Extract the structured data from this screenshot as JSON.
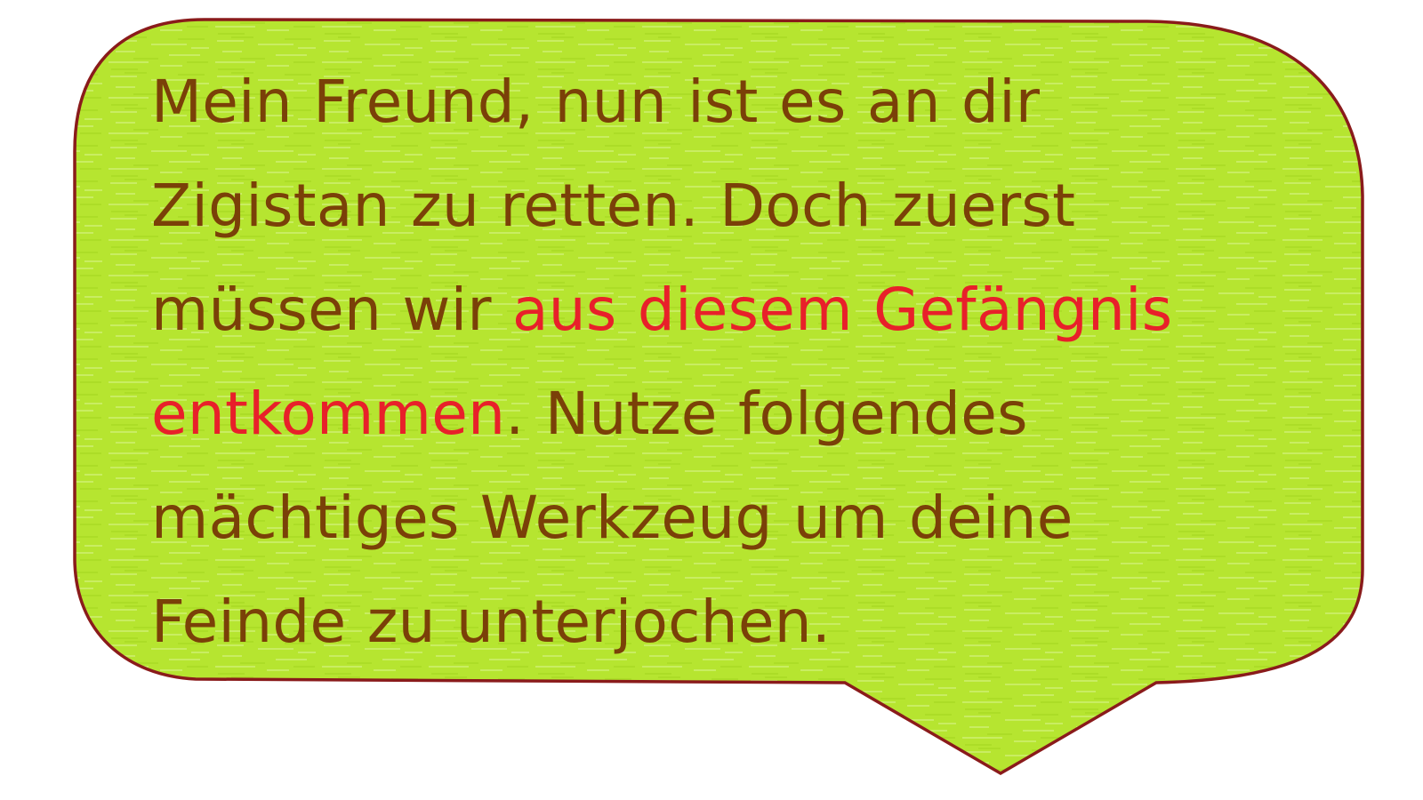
{
  "colors": {
    "fill": "#b6e530",
    "border": "#8a1b1b",
    "text": "#7a4008",
    "highlight": "#e8202a"
  },
  "dialog": {
    "lines": [
      [
        {
          "text": "Mein Freund, nun ist es an dir",
          "highlight": false
        }
      ],
      [
        {
          "text": "Zigistan zu retten. Doch zuerst",
          "highlight": false
        }
      ],
      [
        {
          "text": "müssen wir ",
          "highlight": false
        },
        {
          "text": "aus diesem Gefängnis",
          "highlight": true
        }
      ],
      [
        {
          "text": "entkommen",
          "highlight": true
        },
        {
          "text": ". Nutze folgendes",
          "highlight": false
        }
      ],
      [
        {
          "text": "mächtiges Werkzeug um deine",
          "highlight": false
        }
      ],
      [
        {
          "text": "Feinde zu unterjochen.",
          "highlight": false
        }
      ]
    ]
  }
}
